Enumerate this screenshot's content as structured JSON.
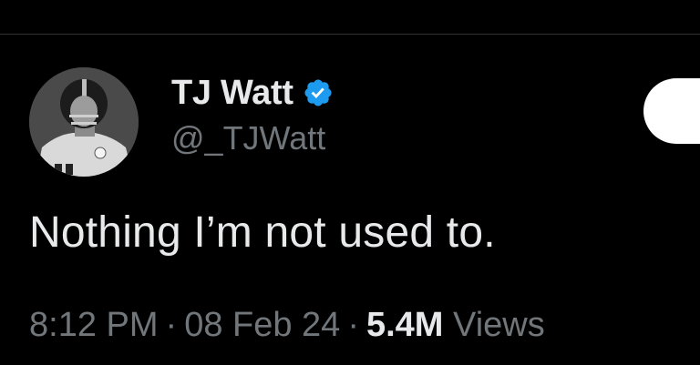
{
  "tweet": {
    "author": {
      "display_name": "TJ Watt",
      "handle": "@_TJWatt",
      "verified": true,
      "avatar_icon": "player-avatar"
    },
    "text": "Nothing I’m not used to.",
    "meta": {
      "time": "8:12 PM",
      "separator": "·",
      "date": "08 Feb 24",
      "views_count": "5.4M",
      "views_label": "Views"
    }
  },
  "colors": {
    "background": "#000000",
    "primary_text": "#e7e9ea",
    "secondary_text": "#71767b",
    "verified_blue": "#1d9bf0",
    "divider": "#2f3336"
  }
}
